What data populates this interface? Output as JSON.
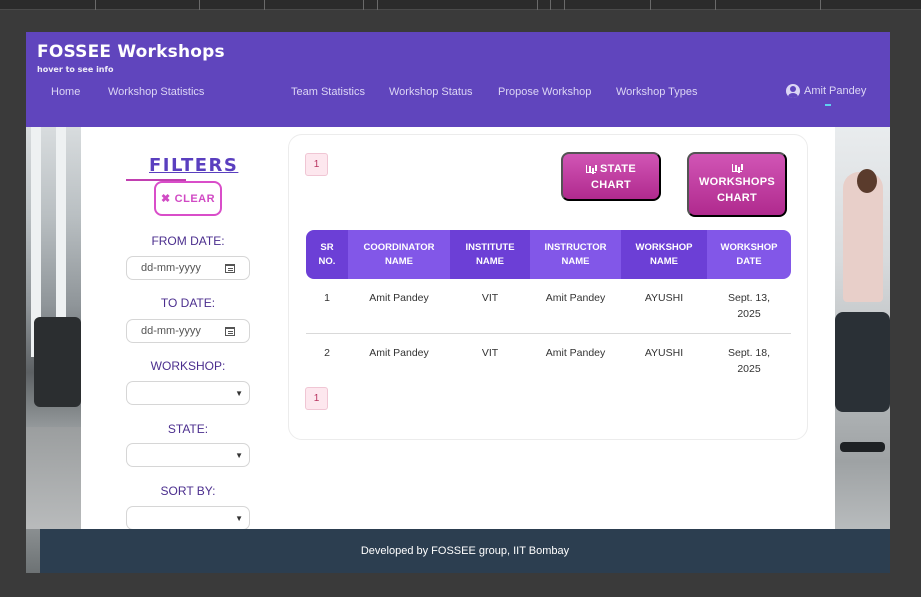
{
  "navbar": {
    "brand": "FOSSEE Workshops",
    "subtitle": "hover to see info",
    "links": [
      "Home",
      "Workshop Statistics",
      "Team Statistics",
      "Workshop Status",
      "Propose Workshop",
      "Workshop Types"
    ],
    "user": "Amit Pandey"
  },
  "filters": {
    "title": "FILTERS",
    "clear_label": "CLEAR",
    "from_date_label": "FROM DATE:",
    "from_date_placeholder": "dd-mm-yyyy",
    "to_date_label": "TO DATE:",
    "to_date_placeholder": "dd-mm-yyyy",
    "workshop_label": "WORKSHOP:",
    "state_label": "STATE:",
    "sort_label": "SORT BY:"
  },
  "pagination": {
    "current_page": "1"
  },
  "buttons": {
    "state_chart": [
      "STATE",
      "CHART"
    ],
    "workshops_chart": [
      "WORKSHOPS",
      "CHART"
    ]
  },
  "table": {
    "headers": [
      [
        "SR",
        "NO."
      ],
      [
        "COORDINATOR",
        "NAME"
      ],
      [
        "INSTITUTE",
        "NAME"
      ],
      [
        "INSTRUCTOR",
        "NAME"
      ],
      [
        "WORKSHOP",
        "NAME"
      ],
      [
        "WORKSHOP",
        "DATE"
      ]
    ],
    "rows": [
      {
        "sr": "1",
        "coordinator": "Amit Pandey",
        "institute": "VIT",
        "instructor": "Amit Pandey",
        "workshop": "AYUSHI",
        "date_line1": "Sept. 13,",
        "date_line2": "2025"
      },
      {
        "sr": "2",
        "coordinator": "Amit Pandey",
        "institute": "VIT",
        "instructor": "Amit Pandey",
        "workshop": "AYUSHI",
        "date_line1": "Sept. 18,",
        "date_line2": "2025"
      }
    ]
  },
  "footer": {
    "text": "Developed by FOSSEE group, IIT Bombay"
  },
  "colors": {
    "navbar": "#6045bd",
    "accent_pink": "#d14ac4",
    "footer": "#2c3e50",
    "header_dark": "#6c3fd6",
    "header_light": "#8257e8"
  },
  "icons": [
    "user-circle-icon",
    "close-icon",
    "calendar-icon",
    "chevron-down-icon",
    "bar-chart-icon"
  ]
}
